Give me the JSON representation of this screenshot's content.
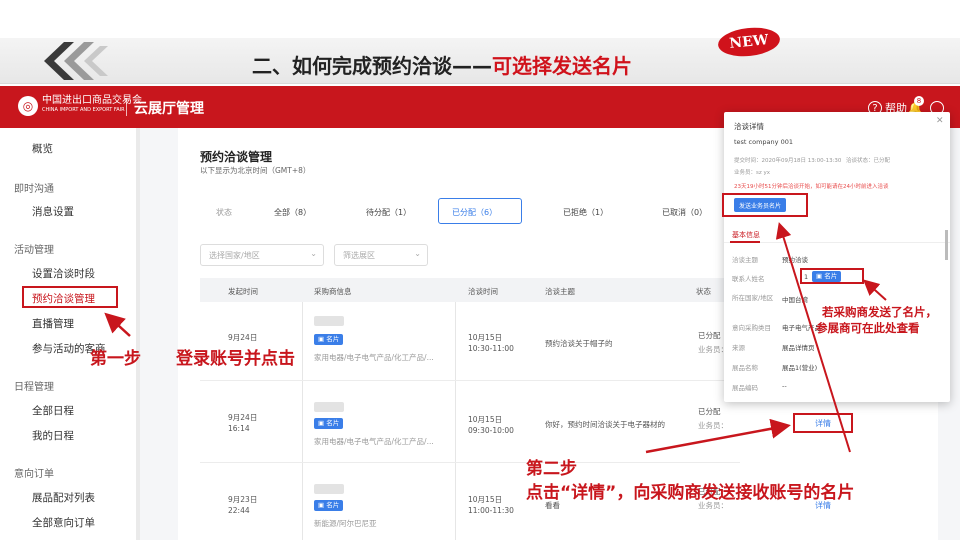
{
  "slide": {
    "title_prefix": "二、如何完成预约洽谈——",
    "title_highlight": "可选择发送名片",
    "badge": "NEW"
  },
  "app": {
    "logo_name": "中国进出口商品交易会",
    "logo_en": "CHINA IMPORT AND EXPORT FAIR",
    "logo_since": "Since 1957",
    "title": "云展厅管理",
    "help": "帮助",
    "notification_count": "8",
    "accent_color": "#c8161d",
    "link_color": "#3a7ee8"
  },
  "sidebar": {
    "overview": "概览",
    "instant_group": "即时沟通",
    "message_settings": "消息设置",
    "activity_group": "活动管理",
    "set_time": "设置洽谈时段",
    "appointments": "预约洽谈管理",
    "live": "直播管理",
    "visitors": "参与活动的客商",
    "schedule_group": "日程管理",
    "all_schedule": "全部日程",
    "my_schedule": "我的日程",
    "intent_group": "意向订单",
    "match_list": "展品配对列表",
    "all_intent": "全部意向订单"
  },
  "main": {
    "title": "预约洽谈管理",
    "subtitle": "以下显示为北京时间（GMT+8）",
    "status_label": "状态",
    "statuses": [
      "全部（8）",
      "待分配（1）",
      "已分配（6）",
      "已拒绝（1）",
      "已取消（0）"
    ],
    "filter_country": "选择国家/地区",
    "filter_region": "筛选展区",
    "columns": [
      "发起时间",
      "采购商信息",
      "洽谈时间",
      "洽谈主题",
      "状态"
    ],
    "rows": [
      {
        "created_date": "9月24日",
        "created_time": "",
        "buyer_tag": "名片",
        "buyer_products": "家用电器/电子电气产品/化工产品/...",
        "meet_date": "10月15日",
        "meet_time": "10:30-11:00",
        "topic": "预约洽谈关于帽子的",
        "status": "已分配",
        "staff": "业务员：",
        "action": ""
      },
      {
        "created_date": "9月24日",
        "created_time": "16:14",
        "buyer_tag": "名片",
        "buyer_products": "家用电器/电子电气产品/化工产品/...",
        "meet_date": "10月15日",
        "meet_time": "09:30-10:00",
        "topic": "你好，预约时间洽谈关于电子器材的",
        "status": "已分配",
        "staff": "业务员：",
        "action": "详情"
      },
      {
        "created_date": "9月23日",
        "created_time": "22:44",
        "buyer_tag": "名片",
        "buyer_products": "新能源/阿尔巴尼亚",
        "meet_date": "10月15日",
        "meet_time": "11:00-11:30",
        "topic": "看看",
        "status": "已分配",
        "staff": "业务员：",
        "action": "详情"
      }
    ]
  },
  "popup": {
    "title": "洽谈详情",
    "company": "test company 001",
    "meta_line": "提交时间：2020年09月18日 13:00-13:30",
    "meta_status": "洽谈状态：已分配",
    "staff_line": "业务员：sz yx",
    "warning": "23天19小时51分钟后洽谈开始，如可能请在24小时前进入洽谈",
    "send_button": "发送业务员名片",
    "tab": "基本信息",
    "fields": [
      {
        "label": "洽谈主题",
        "value": "预约洽谈"
      },
      {
        "label": "联系人姓名",
        "value": "1"
      },
      {
        "label": "所在国家/地区",
        "value": "中国台湾"
      },
      {
        "label": "意向采购类目",
        "value": "电子电气产品..."
      },
      {
        "label": "来源",
        "value": "展品详情页"
      },
      {
        "label": "展品名称",
        "value": "展品1(营业)"
      },
      {
        "label": "展品编码",
        "value": "--"
      }
    ],
    "mini_tag": "名片"
  },
  "annotations": {
    "step1_a": "第一步",
    "step1_b": "登录账号并点击",
    "step2_a": "第二步",
    "step2_b": "点击“详情”，向采购商发送接收账号的名片",
    "note_a": "若采购商发送了名片，",
    "note_b": "参展商可在此处查看"
  }
}
